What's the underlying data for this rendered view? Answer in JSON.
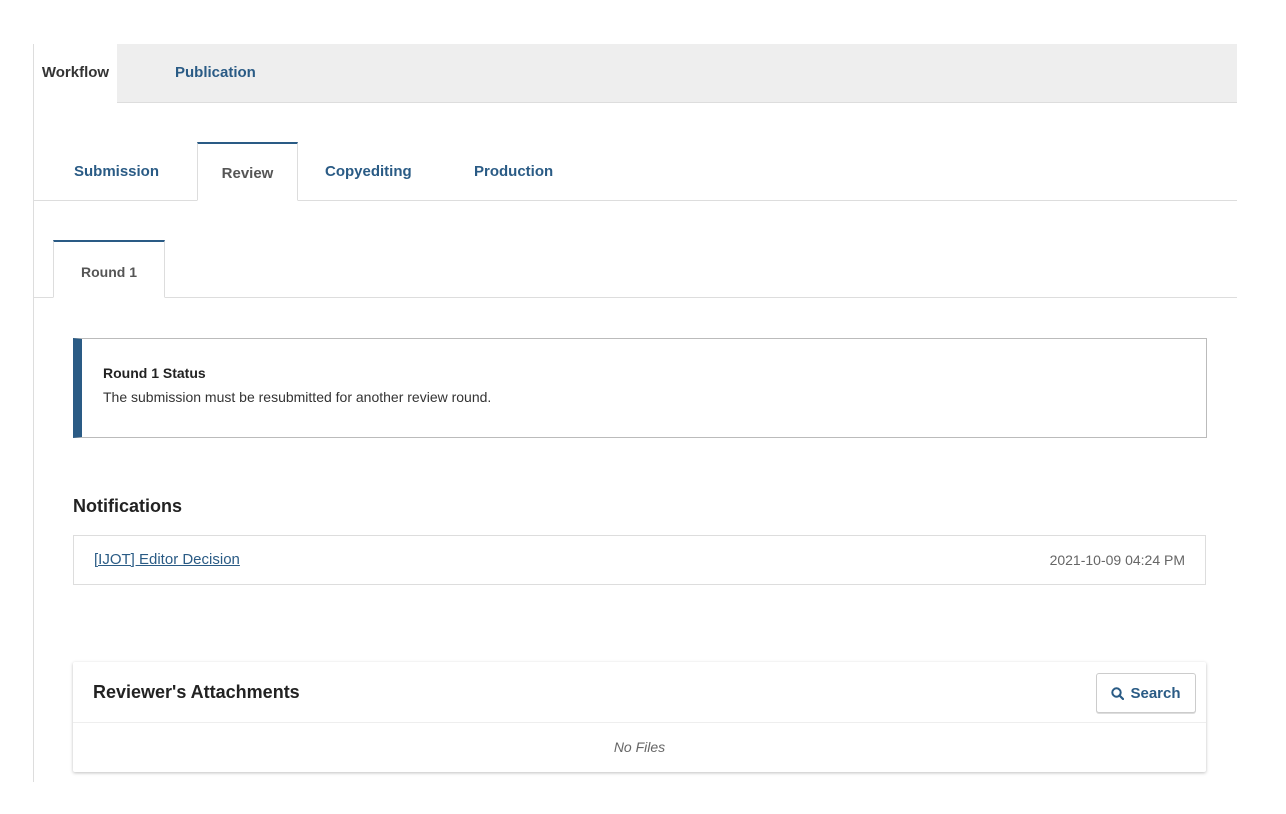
{
  "top_tabs": [
    {
      "label": "Workflow"
    },
    {
      "label": "Publication"
    }
  ],
  "stage_tabs": [
    {
      "label": "Submission"
    },
    {
      "label": "Review"
    },
    {
      "label": "Copyediting"
    },
    {
      "label": "Production"
    }
  ],
  "round_tabs": [
    {
      "label": "Round 1"
    }
  ],
  "status": {
    "title": "Round 1 Status",
    "text": "The submission must be resubmitted for another review round."
  },
  "notifications": {
    "heading": "Notifications",
    "items": [
      {
        "label": "[IJOT] Editor Decision",
        "date": "2021-10-09 04:24 PM"
      }
    ]
  },
  "attachments": {
    "title": "Reviewer's Attachments",
    "search_label": "Search",
    "empty_text": "No Files"
  },
  "colors": {
    "accent": "#2a5b85",
    "tab_bar_bg": "#eeeeee"
  }
}
